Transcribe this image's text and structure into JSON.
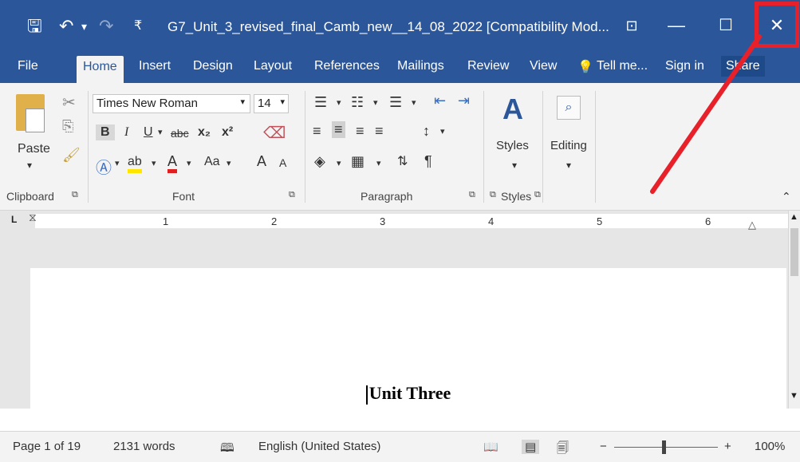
{
  "window": {
    "title": "G7_Unit_3_revised_final_Camb_new__14_08_2022 [Compatibility Mod...",
    "controls": {
      "ribbon_display": "⊡",
      "minimize": "—",
      "maximize": "☐",
      "close": "✕"
    }
  },
  "quick_access": {
    "save": "🖫",
    "undo": "↶",
    "undo_dd": "▾",
    "redo": "↷",
    "customize": "₹"
  },
  "tabs": [
    "File",
    "Home",
    "Insert",
    "Design",
    "Layout",
    "References",
    "Mailings",
    "Review",
    "View"
  ],
  "tell_me": "Tell me...",
  "sign_in": "Sign in",
  "share": "Share",
  "ribbon": {
    "clipboard": {
      "paste": "Paste",
      "label": "Clipboard"
    },
    "font": {
      "name": "Times New Roman",
      "size": "14",
      "bold": "B",
      "italic": "I",
      "underline": "U",
      "strike": "abc",
      "subscript": "x₂",
      "superscript": "x²",
      "change_case": "Aa",
      "grow": "A",
      "shrink": "A",
      "label": "Font"
    },
    "paragraph": {
      "label": "Paragraph",
      "pilcrow": "¶"
    },
    "styles": {
      "button": "Styles",
      "label": "Styles"
    },
    "editing": {
      "button": "Editing"
    }
  },
  "ruler": {
    "tab_marker": "L",
    "numbers": [
      "1",
      "2",
      "3",
      "4",
      "5",
      "6"
    ]
  },
  "document": {
    "heading": "Unit Three"
  },
  "status": {
    "page": "Page 1 of 19",
    "words": "2131 words",
    "language": "English (United States)",
    "zoom": "100%"
  },
  "colors": {
    "word_blue": "#2b579a",
    "ribbon_bg": "#f3f3f3",
    "annotation_red": "#e8202a"
  }
}
